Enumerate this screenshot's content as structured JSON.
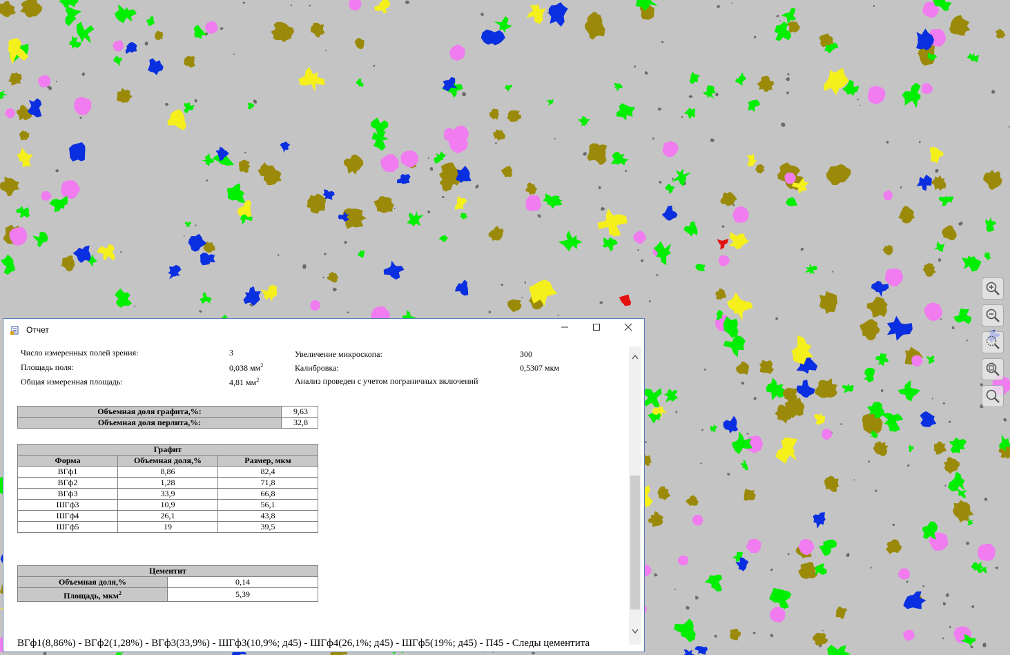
{
  "window": {
    "title": "Отчет"
  },
  "info": {
    "fields_label": "Число измеренных полей зрения:",
    "fields_value": "3",
    "field_area_label": "Площадь поля:",
    "field_area_value": "0,038 мм",
    "field_area_sup": "2",
    "total_area_label": "Общая измеренная площадь:",
    "total_area_value": "4,81 мм",
    "total_area_sup": "2",
    "magnification_label": "Увеличение микроскопа:",
    "magnification_value": "300",
    "calibration_label": "Калибровка:",
    "calibration_value": "0,5307 мкм",
    "analysis_note": "Анализ проведен с учетом пограничных включений"
  },
  "volume_fractions": {
    "graphite_label": "Объемная доля графита,%:",
    "graphite_value": "9,63",
    "pearlite_label": "Объемная доля перлита,%:",
    "pearlite_value": "32,8"
  },
  "graphite_table": {
    "title": "Графит",
    "headers": [
      "Форма",
      "Объемная доля,%",
      "Размер, мкм"
    ],
    "rows": [
      [
        "ВГф1",
        "8,86",
        "82,4"
      ],
      [
        "ВГф2",
        "1,28",
        "71,8"
      ],
      [
        "ВГф3",
        "33,9",
        "66,8"
      ],
      [
        "ШГф3",
        "10,9",
        "56,1"
      ],
      [
        "ШГф4",
        "26,1",
        "43,8"
      ],
      [
        "ШГф5",
        "19",
        "39,5"
      ]
    ]
  },
  "cementite_table": {
    "title": "Цементит",
    "fraction_label": "Объемная доля,%",
    "fraction_value": "0,14",
    "area_label": "Площадь, мкм",
    "area_sup": "2",
    "area_value": "5,39"
  },
  "summary": "ВГф1(8,86%) - ВГф2(1,28%) - ВГф3(33,9%) - ШГф3(10,9%; д45) - ШГф4(26,1%; д45) - ШГф5(19%; д45) - П45 - Следы цементита",
  "micrograph": {
    "background_color": "#c4c4c4",
    "particle_colors": {
      "VGf": "#00ee00",
      "ShGf_olive": "#9b8a0a",
      "ShGf_pink": "#f07cf0",
      "blue": "#0a2fe0",
      "yellow": "#f5f01c",
      "red": "#e51010",
      "dark_specks": "#6a6a6a"
    }
  },
  "toolbar": {
    "icons": [
      "zoom-in-icon",
      "zoom-out-icon",
      "zoom-area-icon",
      "zoom-fit-icon",
      "magnifier-icon"
    ]
  }
}
